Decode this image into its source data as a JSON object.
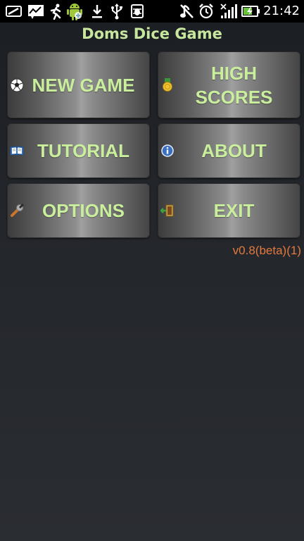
{
  "status_bar": {
    "time": "21:42",
    "icons": [
      "notification-icon",
      "chart-icon",
      "runner-icon",
      "android-icon",
      "download-icon",
      "usb-icon",
      "debug-icon",
      "mute-icon",
      "alarm-icon",
      "signal-icon",
      "battery-icon"
    ]
  },
  "app": {
    "title": "Doms Dice Game",
    "version": "v0.8(beta)(1)"
  },
  "menu": {
    "new_game": "NEW GAME",
    "high_scores_line1": "HIGH",
    "high_scores_line2": "SCORES",
    "tutorial": "TUTORIAL",
    "about": "ABOUT",
    "options": "OPTIONS",
    "exit": "EXIT"
  },
  "colors": {
    "title_text": "#c7e79e",
    "button_text": "#c9ef9d",
    "version_text": "#e4793f",
    "background": "#23262b"
  }
}
